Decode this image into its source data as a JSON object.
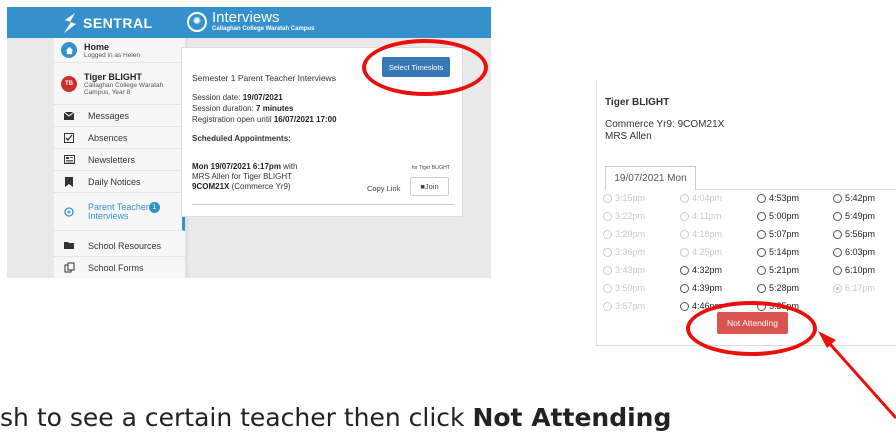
{
  "colors": {
    "accent": "#3591cc",
    "annotation_red": "#e8110d",
    "danger_button": "#d9534f",
    "home_icon": "#3591cc",
    "student_avatar": "#c9302c"
  },
  "left_screen": {
    "brand": "SENTRAL",
    "page_icon": "compass-icon",
    "page_title": "Interviews",
    "page_subtitle": "Callaghan College Waratah Campus",
    "sidebar": {
      "home_title": "Home",
      "home_sub": "Logged in as Helen",
      "student_initials": "TB",
      "student_name": "Tiger BLIGHT",
      "student_school_1": "Callaghan College Waratah",
      "student_school_2": "Campus, Year 8",
      "items": [
        {
          "label": "Messages",
          "icon": "envelope-icon"
        },
        {
          "label": "Absences",
          "icon": "checkbox-icon"
        },
        {
          "label": "Newsletters",
          "icon": "newspaper-icon"
        },
        {
          "label": "Daily Notices",
          "icon": "bookmark-icon"
        },
        {
          "label": "Parent Teacher Interviews",
          "icon": "compass-icon",
          "badge": "1"
        },
        {
          "label": "School Resources",
          "icon": "folder-icon"
        },
        {
          "label": "School Forms",
          "icon": "forms-icon"
        }
      ]
    },
    "card": {
      "heading": "Semester 1 Parent Teacher Interviews",
      "select_button": "Select Timeslots",
      "session_date_label": "Session date: ",
      "session_date": "19/07/2021",
      "duration_label": "Session duration: ",
      "duration": "7 minutes",
      "registration_label": "Registration open until ",
      "registration": "16/07/2021 17:00",
      "scheduled_heading": "Scheduled Appointments:",
      "appt_time": "Mon 19/07/2021 6:17pm",
      "appt_with": " with",
      "appt_line2": "MRS Allen for Tiger BLIGHT",
      "appt_class": "9COM21X",
      "appt_subject": " (Commerce Yr9)",
      "for_label": "for Tiger BLIGHT",
      "copy_link": "Copy Link",
      "join": "Join"
    }
  },
  "right_screen": {
    "student": "Tiger BLIGHT",
    "class_line": "Commerce Yr9: 9COM21X",
    "teacher": "MRS Allen",
    "date_tab": "19/07/2021 Mon",
    "columns": [
      [
        {
          "time": "3:15pm",
          "disabled": true
        },
        {
          "time": "3:22pm",
          "disabled": true
        },
        {
          "time": "3:29pm",
          "disabled": true
        },
        {
          "time": "3:36pm",
          "disabled": true
        },
        {
          "time": "3:43pm",
          "disabled": true
        },
        {
          "time": "3:50pm",
          "disabled": true
        },
        {
          "time": "3:57pm",
          "disabled": true
        }
      ],
      [
        {
          "time": "4:04pm",
          "disabled": true
        },
        {
          "time": "4:11pm",
          "disabled": true
        },
        {
          "time": "4:18pm",
          "disabled": true
        },
        {
          "time": "4:25pm",
          "disabled": true
        },
        {
          "time": "4:32pm",
          "disabled": false
        },
        {
          "time": "4:39pm",
          "disabled": false
        },
        {
          "time": "4:46pm",
          "disabled": false
        }
      ],
      [
        {
          "time": "4:53pm",
          "disabled": false
        },
        {
          "time": "5:00pm",
          "disabled": false
        },
        {
          "time": "5:07pm",
          "disabled": false
        },
        {
          "time": "5:14pm",
          "disabled": false
        },
        {
          "time": "5:21pm",
          "disabled": false
        },
        {
          "time": "5:28pm",
          "disabled": false
        },
        {
          "time": "5:35pm",
          "disabled": false
        }
      ],
      [
        {
          "time": "5:42pm",
          "disabled": false
        },
        {
          "time": "5:49pm",
          "disabled": false
        },
        {
          "time": "5:56pm",
          "disabled": false
        },
        {
          "time": "6:03pm",
          "disabled": false
        },
        {
          "time": "6:10pm",
          "disabled": false
        },
        {
          "time": "6:17pm",
          "disabled": true,
          "checked": true
        }
      ]
    ],
    "not_attending": "Not Attending"
  },
  "caption": {
    "prefix": "sh to see a certain teacher then click ",
    "bold": "Not Attending"
  }
}
